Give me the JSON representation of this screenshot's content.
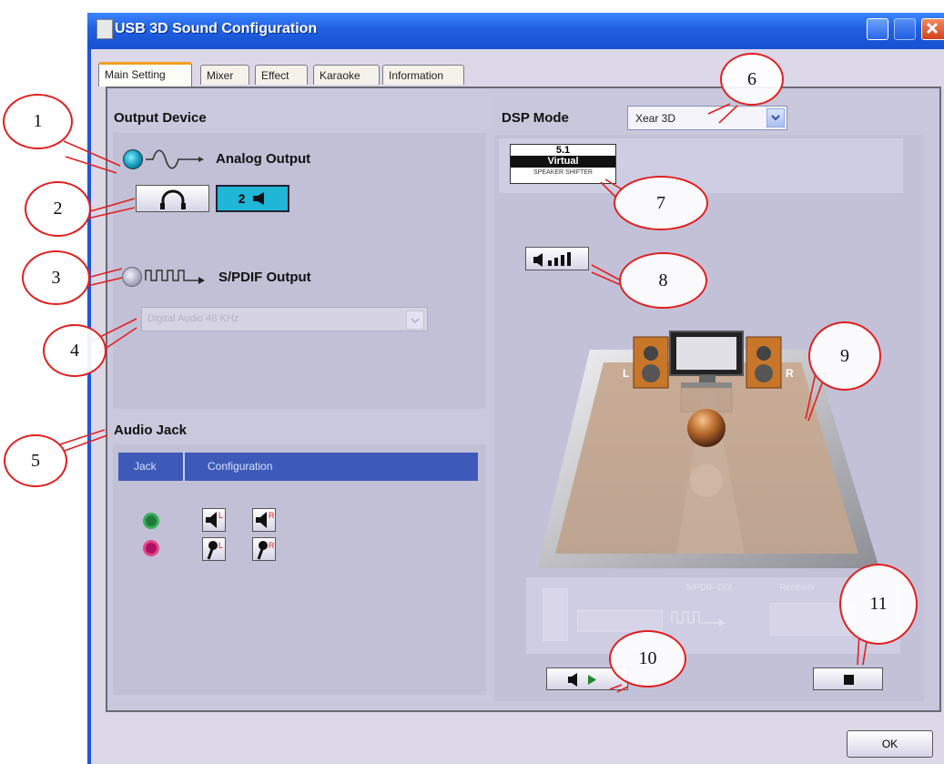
{
  "window": {
    "title": "USB 3D Sound Configuration",
    "tabs": [
      "Main Setting",
      "Mixer",
      "Effect",
      "Karaoke",
      "Information"
    ],
    "active_tab": "Main Setting"
  },
  "output_device": {
    "heading": "Output Device",
    "analog_label": "Analog Output",
    "speaker_mode_label": "2",
    "spdif_label": "S/PDIF Output",
    "spdif_select_value": "Digital Audio 48 KHz"
  },
  "audio_jack": {
    "heading": "Audio Jack",
    "columns": [
      "Jack",
      "Configuration"
    ],
    "rows": [
      {
        "jack_color": "#1f7a3a",
        "config": [
          "L",
          "R"
        ]
      },
      {
        "jack_color": "#b01060",
        "config": [
          "L",
          "R"
        ]
      }
    ]
  },
  "dsp": {
    "heading": "DSP Mode",
    "select_value": "Xear 3D",
    "virtual_badge": {
      "top": "5.1",
      "middle": "Virtual",
      "bottom": "SPEAKER SHIFTER"
    }
  },
  "scene": {
    "left_label": "L",
    "right_label": "R",
    "spdif_out_label": "S/PDIF Out",
    "receiver_label": "Receiver"
  },
  "buttons": {
    "ok": "OK"
  },
  "callouts": [
    "1",
    "2",
    "3",
    "4",
    "5",
    "6",
    "7",
    "8",
    "9",
    "10",
    "11"
  ],
  "colors": {
    "titlebar": "#1f5fe0",
    "table_header": "#3d5ab8",
    "callout": "#e02020"
  }
}
